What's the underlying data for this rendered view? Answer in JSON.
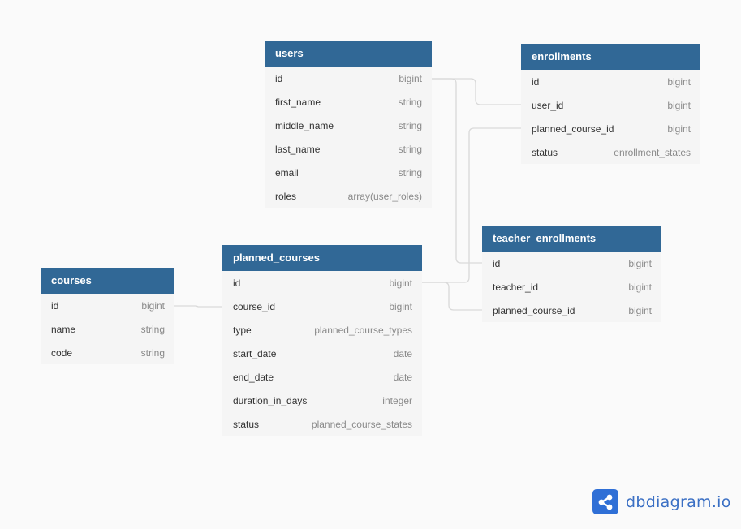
{
  "tables": {
    "users": {
      "name": "users",
      "columns": [
        {
          "name": "id",
          "type": "bigint"
        },
        {
          "name": "first_name",
          "type": "string"
        },
        {
          "name": "middle_name",
          "type": "string"
        },
        {
          "name": "last_name",
          "type": "string"
        },
        {
          "name": "email",
          "type": "string"
        },
        {
          "name": "roles",
          "type": "array(user_roles)"
        }
      ]
    },
    "enrollments": {
      "name": "enrollments",
      "columns": [
        {
          "name": "id",
          "type": "bigint"
        },
        {
          "name": "user_id",
          "type": "bigint"
        },
        {
          "name": "planned_course_id",
          "type": "bigint"
        },
        {
          "name": "status",
          "type": "enrollment_states"
        }
      ]
    },
    "teacher_enrollments": {
      "name": "teacher_enrollments",
      "columns": [
        {
          "name": "id",
          "type": "bigint"
        },
        {
          "name": "teacher_id",
          "type": "bigint"
        },
        {
          "name": "planned_course_id",
          "type": "bigint"
        }
      ]
    },
    "planned_courses": {
      "name": "planned_courses",
      "columns": [
        {
          "name": "id",
          "type": "bigint"
        },
        {
          "name": "course_id",
          "type": "bigint"
        },
        {
          "name": "type",
          "type": "planned_course_types"
        },
        {
          "name": "start_date",
          "type": "date"
        },
        {
          "name": "end_date",
          "type": "date"
        },
        {
          "name": "duration_in_days",
          "type": "integer"
        },
        {
          "name": "status",
          "type": "planned_course_states"
        }
      ]
    },
    "courses": {
      "name": "courses",
      "columns": [
        {
          "name": "id",
          "type": "bigint"
        },
        {
          "name": "name",
          "type": "string"
        },
        {
          "name": "code",
          "type": "string"
        }
      ]
    }
  },
  "relationships": [
    {
      "from": "users.id",
      "to": "enrollments.user_id"
    },
    {
      "from": "users.id",
      "to": "teacher_enrollments.id"
    },
    {
      "from": "planned_courses.id",
      "to": "enrollments.planned_course_id"
    },
    {
      "from": "planned_courses.id",
      "to": "teacher_enrollments.planned_course_id"
    },
    {
      "from": "courses.id",
      "to": "planned_courses.course_id"
    }
  ],
  "colors": {
    "header": "#316896",
    "brand": "#2f6fd6"
  },
  "brand": {
    "text": "dbdiagram.io",
    "icon": "share-icon"
  }
}
